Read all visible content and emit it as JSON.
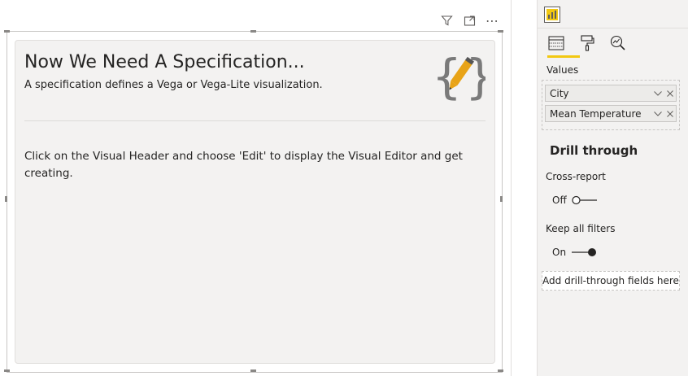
{
  "visual": {
    "title": "Now We Need A Specification...",
    "subtitle": "A specification defines a Vega or Vega-Lite visualization.",
    "body": "Click on the Visual Header and choose 'Edit' to display the Visual Editor and get creating.",
    "header_icons": [
      "filter-icon",
      "focus-mode-icon",
      "more-options-icon"
    ],
    "more_glyph": "⋯"
  },
  "pane": {
    "visual_icon": "deneb-visual-icon",
    "tabs": [
      "fields-icon",
      "format-paint-icon",
      "analytics-icon"
    ],
    "values_label": "Values",
    "fields": [
      {
        "name": "City"
      },
      {
        "name": "Mean Temperature"
      }
    ],
    "drill_through": {
      "heading": "Drill through",
      "cross_report_label": "Cross-report",
      "cross_report_state": "Off",
      "keep_filters_label": "Keep all filters",
      "keep_filters_state": "On",
      "drop_zone": "Add drill-through fields here"
    }
  },
  "colors": {
    "accent": "#f2c811",
    "logo_orange": "#e8a317",
    "logo_grey": "#7a7a7a",
    "pane_bg": "#f3f2f1",
    "card_bg": "#f3f2f1"
  }
}
